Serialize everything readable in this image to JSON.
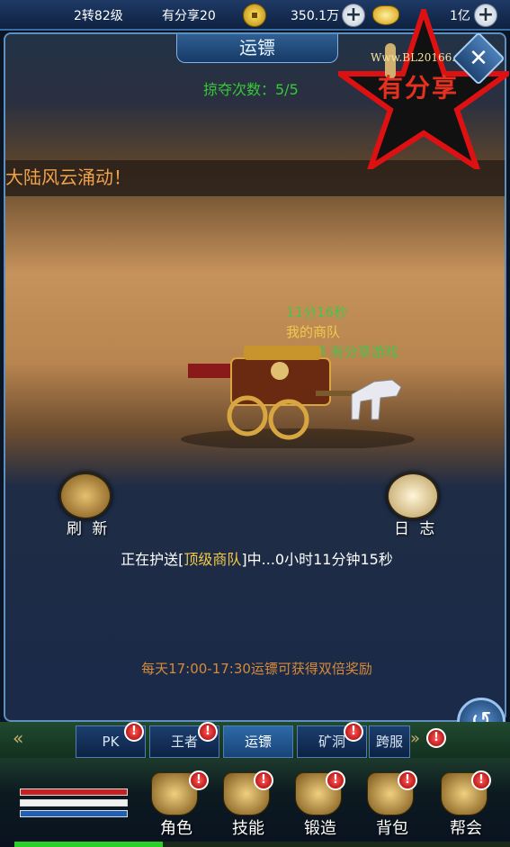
{
  "topbar": {
    "level": "2转82级",
    "vip": "有分享20",
    "gold": "350.1万",
    "ingot": "1亿"
  },
  "panel": {
    "title": "运镖",
    "plunder_count": "掠夺次数：5/5",
    "marquee": "大陆风云涌动！",
    "convoy": {
      "timer": "11分16秒",
      "name": "我的商队",
      "owner": "有分享 有分享游戏"
    },
    "refresh_label": "刷 新",
    "log_label": "日 志",
    "escort_prefix": "正在护送[",
    "escort_rank": "顶级商队",
    "escort_suffix": "]中...0小时11分钟15秒",
    "bonus_tip": "每天17:00-17:30运镖可获得双倍奖励"
  },
  "logo": {
    "url_text": "Www.BL20166.Com",
    "brand": "有分享"
  },
  "tabs": [
    {
      "label": "PK",
      "badge": "!"
    },
    {
      "label": "王者",
      "badge": "!"
    },
    {
      "label": "运镖",
      "badge": ""
    },
    {
      "label": "矿洞",
      "badge": "!"
    },
    {
      "label": "跨服",
      "badge": "!"
    }
  ],
  "dock": [
    {
      "label": "角色",
      "badge": "!"
    },
    {
      "label": "技能",
      "badge": "!"
    },
    {
      "label": "锻造",
      "badge": "!"
    },
    {
      "label": "背包",
      "badge": "!"
    },
    {
      "label": "帮会",
      "badge": "!"
    }
  ],
  "progress": 0.3,
  "icons": {
    "coin": "coin-icon",
    "ingot": "ingot-icon",
    "plus": "plus-icon",
    "close": "close-icon",
    "back": "return-icon",
    "refresh": "refresh-icon",
    "log": "scroll-icon"
  }
}
